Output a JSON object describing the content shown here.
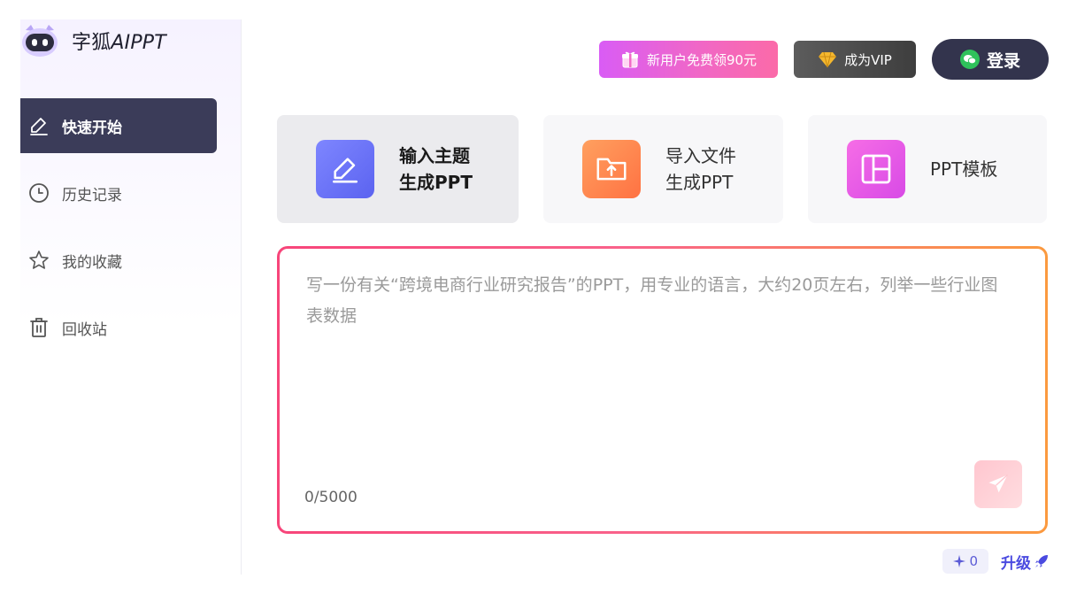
{
  "app": {
    "brand_prefix": "字狐",
    "brand_suffix": "AIPPT"
  },
  "sidebar": {
    "items": [
      {
        "label": "快速开始",
        "icon": "pen-icon",
        "active": true
      },
      {
        "label": "历史记录",
        "icon": "clock-icon",
        "active": false
      },
      {
        "label": "我的收藏",
        "icon": "star-icon",
        "active": false
      },
      {
        "label": "回收站",
        "icon": "trash-icon",
        "active": false
      }
    ]
  },
  "header": {
    "gift_label": "新用户免费领90元",
    "vip_label": "成为VIP",
    "login_label": "登录"
  },
  "modes": [
    {
      "line1": "输入主题",
      "line2": "生成PPT",
      "icon": "pen-icon",
      "active": true
    },
    {
      "line1": "导入文件",
      "line2": "生成PPT",
      "icon": "upload-folder-icon",
      "active": false
    },
    {
      "line1": "PPT模板",
      "line2": "",
      "icon": "template-grid-icon",
      "active": false
    }
  ],
  "editor": {
    "placeholder": "写一份有关“跨境电商行业研究报告”的PPT，用专业的语言，大约20页左右，列举一些行业图表数据",
    "counter": "0/5000"
  },
  "footer": {
    "credits": "0",
    "upgrade_label": "升级"
  },
  "colors": {
    "accent_dark": "#3b3c59",
    "border_start": "#f7457a",
    "border_end": "#fb9a3f",
    "link": "#4a4ae0"
  }
}
